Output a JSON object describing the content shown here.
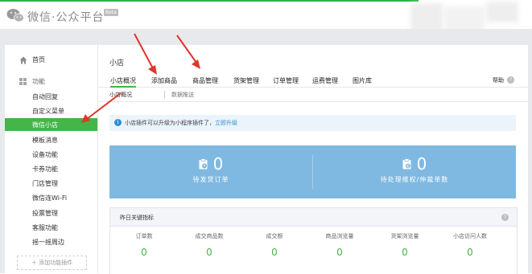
{
  "header": {
    "brand": "微信·公众平台",
    "beta": "Beta"
  },
  "sidebar": {
    "home": "首页",
    "functions": "功能",
    "items": [
      "自动回复",
      "自定义菜单",
      "微信小店",
      "模板消息",
      "设备功能",
      "卡券功能",
      "门店管理",
      "微信连Wi-Fi",
      "投票管理",
      "客服功能",
      "摇一摇周边"
    ],
    "active_index": 2,
    "add_plugin": "＋ 添加功能插件"
  },
  "main": {
    "title": "小店",
    "tabs": [
      "小店概况",
      "添加商品",
      "商品管理",
      "货架管理",
      "订单管理",
      "运费管理",
      "图片库"
    ],
    "active_tab": 0,
    "help": "帮助",
    "subtabs": [
      "小店概况",
      "数据推送"
    ],
    "notice": {
      "text": "小店插件可以升级为小程序插件了，",
      "link": "立即升级"
    },
    "stats": [
      {
        "label": "待发货订单",
        "value": "0"
      },
      {
        "label": "待处理维权/仲裁单数",
        "value": "0"
      }
    ],
    "metrics": {
      "title": "昨日关键指标",
      "items": [
        {
          "label": "订单数",
          "value": "0"
        },
        {
          "label": "成交商品数",
          "value": "0"
        },
        {
          "label": "成交额",
          "value": "0"
        },
        {
          "label": "商品浏览量",
          "value": "0"
        },
        {
          "label": "货架浏览量",
          "value": "0"
        },
        {
          "label": "小店访问人数",
          "value": "0"
        }
      ]
    }
  },
  "colors": {
    "brand_green": "#44b549",
    "banner_blue": "#7fb9e2",
    "metric_green": "#44b549",
    "arrow_red": "#e0352b"
  },
  "icons": [
    "wechat-logo-icon",
    "home-icon",
    "grid-icon",
    "info-icon",
    "clipboard-clock-icon",
    "clipboard-return-icon",
    "help-icon",
    "question-icon"
  ]
}
